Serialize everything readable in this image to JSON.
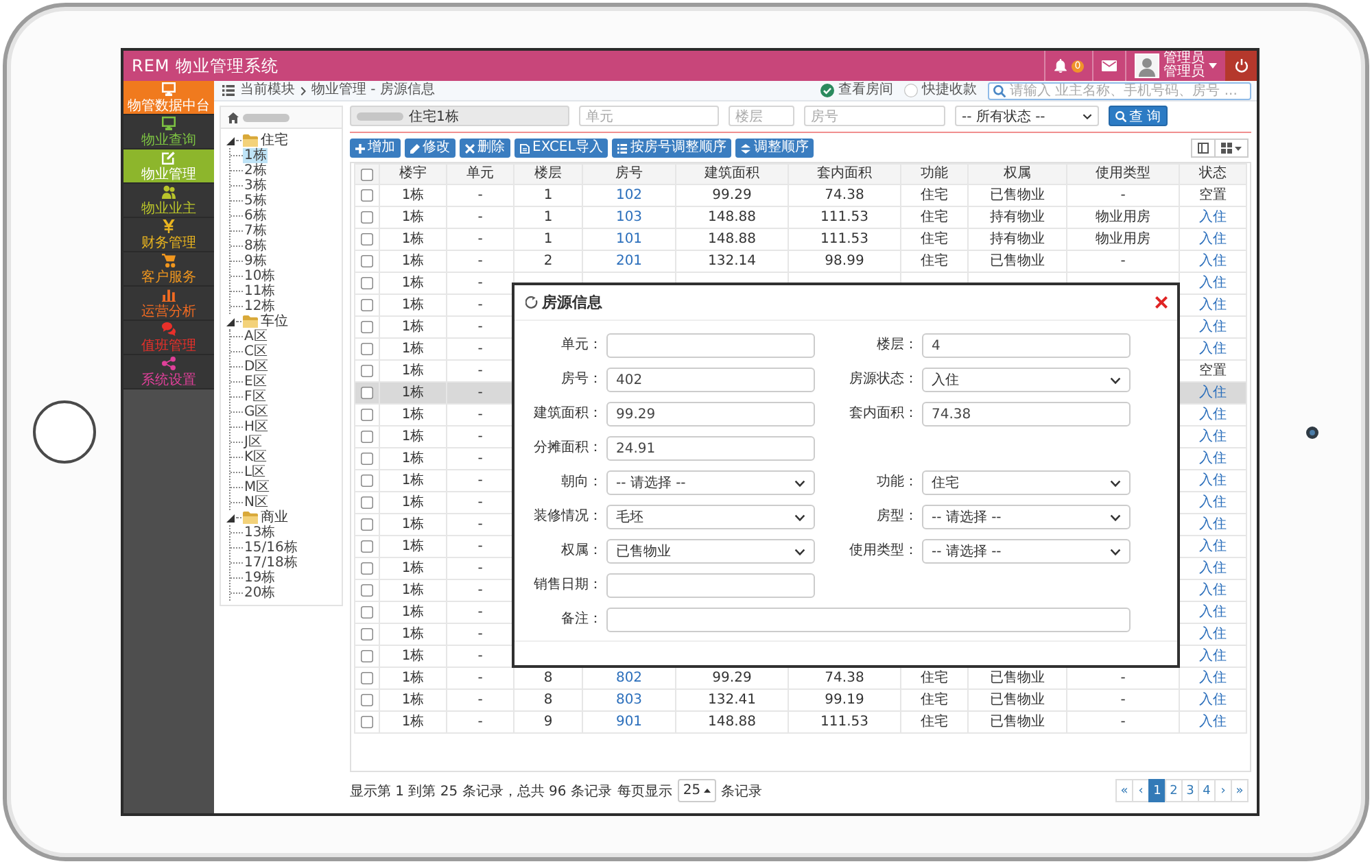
{
  "header": {
    "title": "REM 物业管理系统",
    "notification_count": "0",
    "user_name": "管理员",
    "user_role": "管理员"
  },
  "sidebar": {
    "items": [
      {
        "label": "物管数据中台",
        "kind": "hub",
        "color": "#f07a1e",
        "selected": false
      },
      {
        "label": "物业查询",
        "kind": "menu",
        "color": "#7cc242",
        "selected": false
      },
      {
        "label": "物业管理",
        "kind": "menu",
        "color": "#8db62c",
        "selected": true
      },
      {
        "label": "物业业主",
        "kind": "menu",
        "color": "#b9c42a",
        "selected": false
      },
      {
        "label": "财务管理",
        "kind": "menu",
        "color": "#e9b41f",
        "selected": false
      },
      {
        "label": "客户服务",
        "kind": "menu",
        "color": "#f0961e",
        "selected": false
      },
      {
        "label": "运营分析",
        "kind": "menu",
        "color": "#f26b22",
        "selected": false
      },
      {
        "label": "值班管理",
        "kind": "menu",
        "color": "#e8302a",
        "selected": false
      },
      {
        "label": "系统设置",
        "kind": "menu",
        "color": "#e0409a",
        "selected": false
      }
    ]
  },
  "breadcrumb": {
    "module": "当前模块",
    "path": "物业管理 - 房源信息"
  },
  "quick_options": [
    {
      "label": "查看房间",
      "selected": true
    },
    {
      "label": "快捷收款",
      "selected": false
    }
  ],
  "global_search": {
    "placeholder": "请输入 业主名称、手机号码、房号 ..."
  },
  "tree": {
    "nodes": [
      {
        "label": "住宅",
        "expanded": true,
        "selected": false,
        "children": [
          {
            "label": "1栋",
            "selected": true
          },
          {
            "label": "2栋",
            "selected": false
          },
          {
            "label": "3栋",
            "selected": false
          },
          {
            "label": "5栋",
            "selected": false
          },
          {
            "label": "6栋",
            "selected": false
          },
          {
            "label": "7栋",
            "selected": false
          },
          {
            "label": "8栋",
            "selected": false
          },
          {
            "label": "9栋",
            "selected": false
          },
          {
            "label": "10栋",
            "selected": false
          },
          {
            "label": "11栋",
            "selected": false
          },
          {
            "label": "12栋",
            "selected": false
          }
        ]
      },
      {
        "label": "车位",
        "expanded": true,
        "selected": false,
        "children": [
          {
            "label": "A区",
            "selected": false
          },
          {
            "label": "C区",
            "selected": false
          },
          {
            "label": "D区",
            "selected": false
          },
          {
            "label": "E区",
            "selected": false
          },
          {
            "label": "F区",
            "selected": false
          },
          {
            "label": "G区",
            "selected": false
          },
          {
            "label": "H区",
            "selected": false
          },
          {
            "label": "J区",
            "selected": false
          },
          {
            "label": "K区",
            "selected": false
          },
          {
            "label": "L区",
            "selected": false
          },
          {
            "label": "M区",
            "selected": false
          },
          {
            "label": "N区",
            "selected": false
          }
        ]
      },
      {
        "label": "商业",
        "expanded": true,
        "selected": false,
        "children": [
          {
            "label": "13栋",
            "selected": false
          },
          {
            "label": "15/16栋",
            "selected": false
          },
          {
            "label": "17/18栋",
            "selected": false
          },
          {
            "label": "19栋",
            "selected": false
          },
          {
            "label": "20栋",
            "selected": false
          }
        ]
      }
    ]
  },
  "filters": [
    {
      "kind": "readonly",
      "value": "住宅1栋"
    },
    {
      "kind": "input",
      "placeholder": "单元"
    },
    {
      "kind": "input",
      "placeholder": "楼层"
    },
    {
      "kind": "input",
      "placeholder": "房号"
    },
    {
      "kind": "select",
      "value": "-- 所有状态 --"
    }
  ],
  "search_button": "查 询",
  "toolbar": [
    "增加",
    "修改",
    "删除",
    "EXCEL导入",
    "按房号调整顺序",
    "调整顺序"
  ],
  "table": {
    "header_checked": false,
    "columns": [
      "楼宇",
      "单元",
      "楼层",
      "房号",
      "建筑面积",
      "套内面积",
      "功能",
      "权属",
      "使用类型",
      "状态"
    ],
    "rows": [
      {
        "checked": false,
        "highlighted": false,
        "building": "1栋",
        "unit": "-",
        "floor": "1",
        "room": "102",
        "area": "99.29",
        "inner_area": "74.38",
        "function": "住宅",
        "ownership": "已售物业",
        "usage": "-",
        "status": "空置",
        "status_link": false
      },
      {
        "checked": false,
        "highlighted": false,
        "building": "1栋",
        "unit": "-",
        "floor": "1",
        "room": "103",
        "area": "148.88",
        "inner_area": "111.53",
        "function": "住宅",
        "ownership": "持有物业",
        "usage": "物业用房",
        "status": "入住",
        "status_link": true
      },
      {
        "checked": false,
        "highlighted": false,
        "building": "1栋",
        "unit": "-",
        "floor": "1",
        "room": "101",
        "area": "148.88",
        "inner_area": "111.53",
        "function": "住宅",
        "ownership": "持有物业",
        "usage": "物业用房",
        "status": "入住",
        "status_link": true
      },
      {
        "checked": false,
        "highlighted": false,
        "building": "1栋",
        "unit": "-",
        "floor": "2",
        "room": "201",
        "area": "132.14",
        "inner_area": "98.99",
        "function": "住宅",
        "ownership": "已售物业",
        "usage": "-",
        "status": "入住",
        "status_link": true
      },
      {
        "checked": false,
        "highlighted": false,
        "building": "1栋",
        "unit": "-",
        "status": "入住",
        "status_link": true
      },
      {
        "checked": false,
        "highlighted": false,
        "building": "1栋",
        "unit": "-",
        "status": "入住",
        "status_link": true
      },
      {
        "checked": false,
        "highlighted": false,
        "building": "1栋",
        "unit": "-",
        "status": "入住",
        "status_link": true
      },
      {
        "checked": false,
        "highlighted": false,
        "building": "1栋",
        "unit": "-",
        "status": "入住",
        "status_link": true
      },
      {
        "checked": false,
        "highlighted": false,
        "building": "1栋",
        "unit": "-",
        "status": "空置",
        "status_link": false
      },
      {
        "checked": false,
        "highlighted": true,
        "building": "1栋",
        "unit": "-",
        "status": "入住",
        "status_link": true
      },
      {
        "checked": false,
        "highlighted": false,
        "building": "1栋",
        "unit": "-",
        "status": "入住",
        "status_link": true
      },
      {
        "checked": false,
        "highlighted": false,
        "building": "1栋",
        "unit": "-",
        "status": "入住",
        "status_link": true
      },
      {
        "checked": false,
        "highlighted": false,
        "building": "1栋",
        "unit": "-",
        "status": "入住",
        "status_link": true
      },
      {
        "checked": false,
        "highlighted": false,
        "building": "1栋",
        "unit": "-",
        "status": "入住",
        "status_link": true
      },
      {
        "checked": false,
        "highlighted": false,
        "building": "1栋",
        "unit": "-",
        "status": "入住",
        "status_link": true
      },
      {
        "checked": false,
        "highlighted": false,
        "building": "1栋",
        "unit": "-",
        "status": "入住",
        "status_link": true
      },
      {
        "checked": false,
        "highlighted": false,
        "building": "1栋",
        "unit": "-",
        "status": "入住",
        "status_link": true
      },
      {
        "checked": false,
        "highlighted": false,
        "building": "1栋",
        "unit": "-",
        "status": "入住",
        "status_link": true
      },
      {
        "checked": false,
        "highlighted": false,
        "building": "1栋",
        "unit": "-",
        "status": "入住",
        "status_link": true
      },
      {
        "checked": false,
        "highlighted": false,
        "building": "1栋",
        "unit": "-",
        "status": "入住",
        "status_link": true
      },
      {
        "checked": false,
        "highlighted": false,
        "building": "1栋",
        "unit": "-",
        "status": "入住",
        "status_link": true
      },
      {
        "checked": false,
        "highlighted": false,
        "building": "1栋",
        "unit": "-",
        "status": "入住",
        "status_link": true
      },
      {
        "checked": false,
        "highlighted": false,
        "building": "1栋",
        "unit": "-",
        "floor": "8",
        "room": "802",
        "area": "99.29",
        "inner_area": "74.38",
        "function": "住宅",
        "ownership": "已售物业",
        "usage": "-",
        "status": "入住",
        "status_link": true
      },
      {
        "checked": false,
        "highlighted": false,
        "building": "1栋",
        "unit": "-",
        "floor": "8",
        "room": "803",
        "area": "132.41",
        "inner_area": "99.19",
        "function": "住宅",
        "ownership": "已售物业",
        "usage": "-",
        "status": "入住",
        "status_link": true
      },
      {
        "checked": false,
        "highlighted": false,
        "building": "1栋",
        "unit": "-",
        "floor": "9",
        "room": "901",
        "area": "148.88",
        "inner_area": "111.53",
        "function": "住宅",
        "ownership": "已售物业",
        "usage": "-",
        "status": "入住",
        "status_link": true
      }
    ]
  },
  "pagination": {
    "summary": "显示第 1 到第 25 条记录，总共 96 条记录",
    "per_page_label": "每页显示",
    "page_size": "25",
    "per_page_suffix": "条记录",
    "pages": [
      {
        "label": "«",
        "selected": false
      },
      {
        "label": "‹",
        "selected": false
      },
      {
        "label": "1",
        "selected": true
      },
      {
        "label": "2",
        "selected": false
      },
      {
        "label": "3",
        "selected": false
      },
      {
        "label": "4",
        "selected": false
      },
      {
        "label": "›",
        "selected": false
      },
      {
        "label": "»",
        "selected": false
      }
    ]
  },
  "dialog": {
    "title": "房源信息",
    "rows": [
      {
        "fields": [
          {
            "kind": "input",
            "label": "单元："
          },
          {
            "kind": "input",
            "label": "楼层：",
            "value": "4"
          }
        ]
      },
      {
        "fields": [
          {
            "kind": "input",
            "label": "房号：",
            "value": "402"
          },
          {
            "kind": "select",
            "label": "房源状态：",
            "value": "入住"
          }
        ]
      },
      {
        "fields": [
          {
            "kind": "input",
            "label": "建筑面积：",
            "value": "99.29"
          },
          {
            "kind": "input",
            "label": "套内面积：",
            "value": "74.38"
          }
        ]
      },
      {
        "fields": [
          {
            "kind": "input",
            "label": "分摊面积：",
            "value": "24.91"
          }
        ]
      },
      {
        "fields": [
          {
            "kind": "select",
            "label": "朝向：",
            "value": "-- 请选择 --"
          },
          {
            "kind": "select",
            "label": "功能：",
            "value": "住宅"
          }
        ]
      },
      {
        "fields": [
          {
            "kind": "select",
            "label": "装修情况：",
            "value": "毛坯"
          },
          {
            "kind": "select",
            "label": "房型：",
            "value": "-- 请选择 --"
          }
        ]
      },
      {
        "fields": [
          {
            "kind": "select",
            "label": "权属：",
            "value": "已售物业"
          },
          {
            "kind": "select",
            "label": "使用类型：",
            "value": "-- 请选择 --"
          }
        ]
      },
      {
        "fields": [
          {
            "kind": "input",
            "label": "销售日期："
          }
        ]
      },
      {
        "fields": [
          {
            "kind": "wide_input",
            "label": "备注："
          }
        ]
      }
    ]
  }
}
